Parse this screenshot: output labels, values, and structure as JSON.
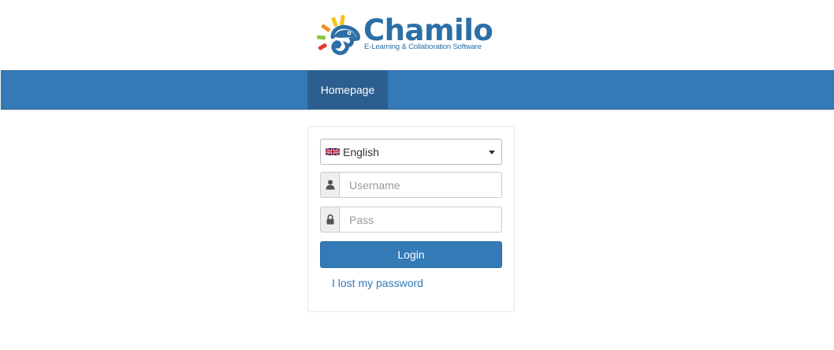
{
  "logo": {
    "title": "Chamilo",
    "tagline": "E-Learning & Collaboration Software",
    "colors": {
      "brand_blue": "#2c6fa6",
      "ray_yellow": "#f6c412",
      "ray_orange": "#f39224",
      "ray_red": "#e63a2f",
      "ray_green": "#8cc63f"
    }
  },
  "nav": {
    "items": [
      {
        "label": "Homepage",
        "active": true
      }
    ],
    "colors": {
      "bar": "#337ab7",
      "active": "#2c5f8f"
    }
  },
  "login": {
    "language": {
      "selected": "English",
      "flag_icon": "uk-flag-icon"
    },
    "username": {
      "placeholder": "Username",
      "value": "",
      "icon": "user-icon"
    },
    "password": {
      "placeholder": "Pass",
      "value": "",
      "icon": "lock-icon"
    },
    "submit_label": "Login",
    "lost_password_label": "I lost my password"
  }
}
